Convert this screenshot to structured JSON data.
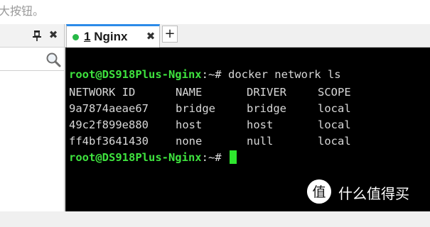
{
  "background_caption": "大按钮。",
  "left_panel": {
    "pin_icon": "pin-icon",
    "close_icon": "✖",
    "search_icon": "search-icon"
  },
  "tabs": [
    {
      "number": "1",
      "label": "Nginx",
      "status_color": "#27b847",
      "close": "✖"
    }
  ],
  "new_tab_label": "+",
  "terminal": {
    "prompt_user": "root@DS918Plus-Nginx",
    "prompt_tail": ":~#",
    "command": "docker network ls",
    "headers": [
      "NETWORK ID",
      "NAME",
      "DRIVER",
      "SCOPE"
    ],
    "rows": [
      [
        "9a7874aeae67",
        "bridge",
        "bridge",
        "local"
      ],
      [
        "49c2f899e880",
        "host",
        "host",
        "local"
      ],
      [
        "ff4bf3641430",
        "none",
        "null",
        "local"
      ]
    ],
    "colors": {
      "prompt": "#3ee23e",
      "text": "#d8d8d8",
      "background": "#000000"
    }
  },
  "watermark": {
    "text": "什么值得买",
    "logo_glyph": "值"
  }
}
